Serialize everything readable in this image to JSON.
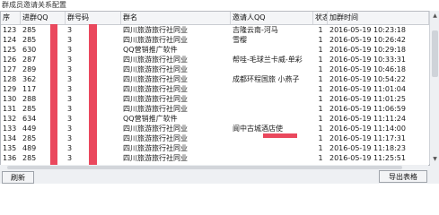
{
  "window": {
    "title": "群成员邀请关系配置"
  },
  "columns": [
    "序",
    "进群QQ",
    "群号码",
    "群名",
    "邀请人QQ",
    "状态",
    "加群时间"
  ],
  "rows": [
    [
      "123",
      "285",
      "3",
      "四川旅游旅行社同业",
      "吉隆云南-河马",
      "1",
      "2016-05-19 10:23:18"
    ],
    [
      "124",
      "285",
      "3",
      "四川旅游旅行社同业",
      "雪樱",
      "1",
      "2016-05-19 10:26:42"
    ],
    [
      "125",
      "630",
      "3",
      "QQ营销推广软件",
      "",
      "1",
      "2016-05-19 10:29:18"
    ],
    [
      "126",
      "287",
      "3",
      "四川旅游旅行社同业",
      "帮哇-毛球兰卡威-单彩",
      "1",
      "2016-05-19 10:33:31"
    ],
    [
      "127",
      "289",
      "3",
      "四川旅游旅行社同业",
      "",
      "1",
      "2016-05-19 10:46:18"
    ],
    [
      "128",
      "362",
      "3",
      "四川旅游旅行社同业",
      "成都环程国旅 小燕子",
      "1",
      "2016-05-19 10:54:22"
    ],
    [
      "129",
      "117",
      "3",
      "四川旅游旅行社同业",
      "",
      "1",
      "2016-05-19 11:01:04"
    ],
    [
      "130",
      "288",
      "3",
      "四川旅游旅行社同业",
      "",
      "1",
      "2016-05-19 11:01:25"
    ],
    [
      "131",
      "285",
      "3",
      "四川旅游旅行社同业",
      "",
      "1",
      "2016-05-19 11:06:59"
    ],
    [
      "132",
      "634",
      "3",
      "QQ营销推广软件",
      "",
      "1",
      "2016-05-19 11:11:24"
    ],
    [
      "133",
      "449",
      "3",
      "四川旅游旅行社同业",
      "阆中古城酒店使",
      "1",
      "2016-05-19 11:14:00"
    ],
    [
      "134",
      "285",
      "3",
      "四川旅游旅行社同业",
      "",
      "1",
      "2016-05-19 11:17:31"
    ],
    [
      "135",
      "489",
      "3",
      "四川旅游旅行社同业",
      "",
      "1",
      "2016-05-19 11:18:23"
    ],
    [
      "136",
      "285",
      "3",
      "四川旅游旅行社同业",
      "",
      "1",
      "2016-05-19 11:25:51"
    ]
  ],
  "buttons": {
    "refresh": "刷新",
    "export": "导出表格"
  }
}
